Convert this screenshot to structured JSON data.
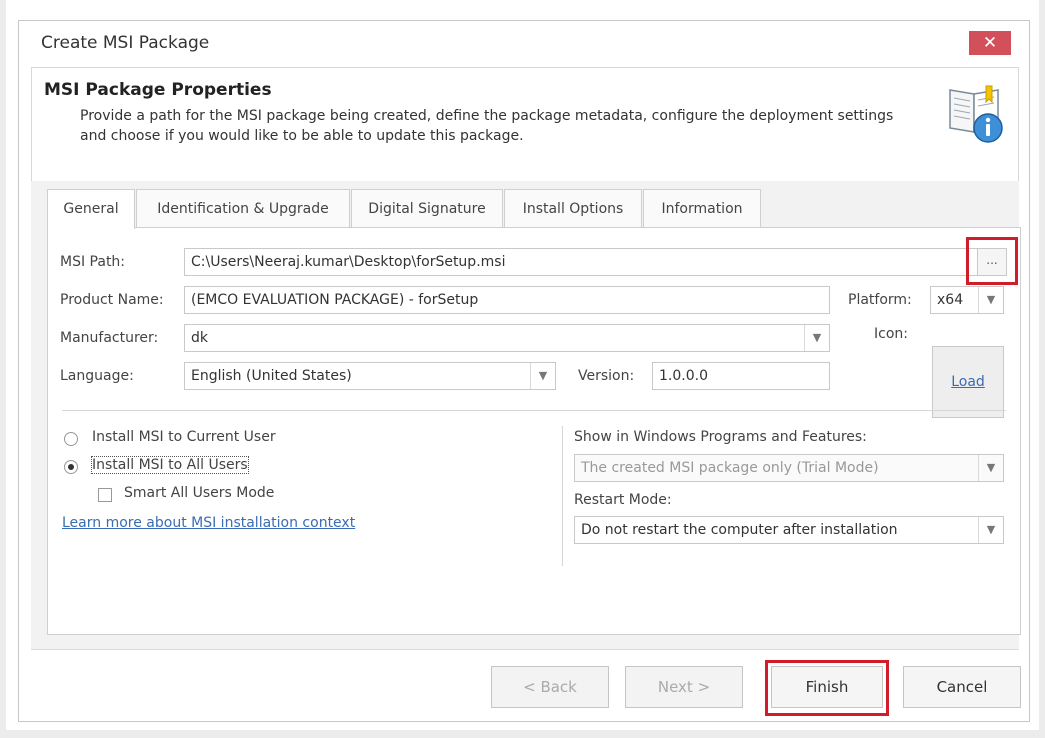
{
  "window": {
    "title": "Create MSI Package",
    "close_symbol": "✕"
  },
  "header": {
    "title": "MSI Package Properties",
    "description": "Provide a path for the MSI package being created, define the package metadata, configure the deployment settings and choose if you would like to be able to update this package.",
    "icon": "book-info-icon"
  },
  "tabs": [
    {
      "label": "General",
      "active": true
    },
    {
      "label": "Identification & Upgrade",
      "active": false
    },
    {
      "label": "Digital Signature",
      "active": false
    },
    {
      "label": "Install Options",
      "active": false
    },
    {
      "label": "Information",
      "active": false
    }
  ],
  "general": {
    "msi_path": {
      "label": "MSI Path:",
      "value": "C:\\Users\\Neeraj.kumar\\Desktop\\forSetup.msi",
      "browse_label": "..."
    },
    "product_name": {
      "label": "Product Name:",
      "value": "(EMCO EVALUATION PACKAGE) - forSetup"
    },
    "platform": {
      "label": "Platform:",
      "value": "x64"
    },
    "manufacturer": {
      "label": "Manufacturer:",
      "value": "dk"
    },
    "icon": {
      "label": "Icon:",
      "load_label": "Load"
    },
    "language": {
      "label": "Language:",
      "value": "English (United States)"
    },
    "version": {
      "label": "Version:",
      "value": "1.0.0.0"
    },
    "install_scope": {
      "options": [
        {
          "label": "Install MSI to Current User",
          "selected": false
        },
        {
          "label": "Install MSI to All Users",
          "selected": true
        }
      ],
      "smart_mode_label": "Smart All Users Mode",
      "smart_mode_checked": false,
      "learn_more_link": "Learn more about MSI installation context"
    },
    "show_in_programs": {
      "label": "Show in Windows Programs and Features:",
      "value": "The created MSI package only (Trial Mode)"
    },
    "restart_mode": {
      "label": "Restart Mode:",
      "value": "Do not restart the computer after installation"
    }
  },
  "footer": {
    "back_label": "< Back",
    "next_label": "Next >",
    "finish_label": "Finish",
    "cancel_label": "Cancel"
  },
  "colors": {
    "highlight": "#d11c2a",
    "link": "#3a6cb3",
    "close_button": "#d1505a"
  }
}
